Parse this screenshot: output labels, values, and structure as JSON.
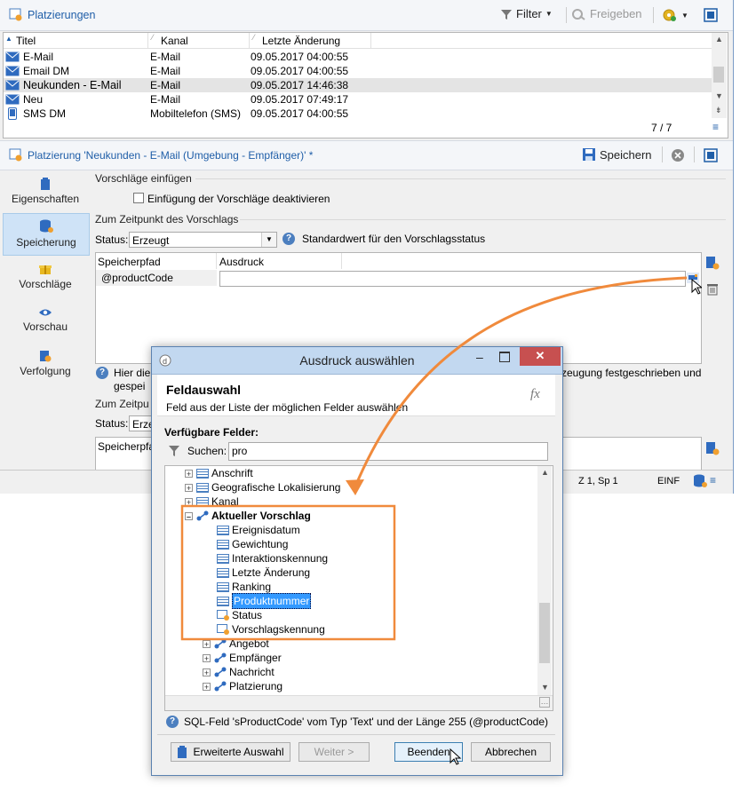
{
  "colors": {
    "accent": "#1f5ea8",
    "orange": "#f08a3c",
    "selection": "#3399ff"
  },
  "top": {
    "title": "Platzierungen",
    "filter": "Filter",
    "release": "Freigeben",
    "columns": [
      "Titel",
      "Kanal",
      "Letzte Änderung"
    ],
    "rows": [
      {
        "title": "E-Mail",
        "channel": "E-Mail",
        "date": "09.05.2017 04:00:55",
        "icon": "envelope-icon"
      },
      {
        "title": "Email DM",
        "channel": "E-Mail",
        "date": "09.05.2017 04:00:55",
        "icon": "envelope-icon"
      },
      {
        "title": "Neukunden - E-Mail",
        "channel": "E-Mail",
        "date": "09.05.2017 14:46:38",
        "icon": "envelope-icon"
      },
      {
        "title": "Neu",
        "channel": "E-Mail",
        "date": "09.05.2017 07:49:17",
        "icon": "envelope-icon"
      },
      {
        "title": "SMS DM",
        "channel": "Mobiltelefon (SMS)",
        "date": "09.05.2017 04:00:55",
        "icon": "mobile-icon"
      }
    ],
    "count": "7 / 7"
  },
  "detail": {
    "title": "Platzierung 'Neukunden - E-Mail (Umgebung - Empfänger)' *",
    "save": "Speichern",
    "nav": [
      "Eigenschaften",
      "Speicherung",
      "Vorschläge",
      "Vorschau",
      "Verfolgung"
    ],
    "section1": "Vorschläge einfügen",
    "checkbox": "Einfügung der Vorschläge deaktivieren",
    "section2": "Zum Zeitpunkt des Vorschlags",
    "status_label": "Status:",
    "status_value": "Erzeugt",
    "status_help": "Standardwert für den Vorschlagsstatus",
    "table_cols": [
      "Speicherpfad",
      "Ausdruck"
    ],
    "table_row": "@productCode",
    "note_left": "Hier die",
    "note_left2": "gespei",
    "note_right": "zeugung festgeschrieben und",
    "section3": "Zum Zeitpu",
    "status_value2": "Erze",
    "table_col2": "Speicherpfa",
    "status_bar": [
      "Z 1, Sp 1",
      "EINF"
    ]
  },
  "dialog": {
    "title": "Ausdruck auswählen",
    "heading": "Feldauswahl",
    "subheading": "Feld aus der Liste der möglichen Felder auswählen",
    "available": "Verfügbare Felder:",
    "search_label": "Suchen:",
    "search_value": "pro",
    "fx": "fx",
    "tree": [
      {
        "label": "Anschrift",
        "level": 1,
        "expander": "+",
        "kind": "table"
      },
      {
        "label": "Geografische Lokalisierung",
        "level": 1,
        "expander": "+",
        "kind": "table"
      },
      {
        "label": "Kanal",
        "level": 1,
        "expander": "+",
        "kind": "table"
      },
      {
        "label": "Aktueller Vorschlag",
        "level": 1,
        "expander": "-",
        "kind": "link",
        "bold": true
      },
      {
        "label": "Ereignisdatum",
        "level": 2,
        "kind": "field"
      },
      {
        "label": "Gewichtung",
        "level": 2,
        "kind": "field"
      },
      {
        "label": "Interaktionskennung",
        "level": 2,
        "kind": "field"
      },
      {
        "label": "Letzte Änderung",
        "level": 2,
        "kind": "field"
      },
      {
        "label": "Ranking",
        "level": 2,
        "kind": "field"
      },
      {
        "label": "Produktnummer",
        "level": 2,
        "kind": "field",
        "selected": true
      },
      {
        "label": "Status",
        "level": 2,
        "kind": "enum"
      },
      {
        "label": "Vorschlagskennung",
        "level": 2,
        "kind": "enum"
      },
      {
        "label": "Angebot",
        "level": 2,
        "expander": "+",
        "kind": "link"
      },
      {
        "label": "Empfänger",
        "level": 2,
        "expander": "+",
        "kind": "link"
      },
      {
        "label": "Nachricht",
        "level": 2,
        "expander": "+",
        "kind": "link"
      },
      {
        "label": "Platzierung",
        "level": 2,
        "expander": "+",
        "kind": "link"
      }
    ],
    "info": "SQL-Feld 'sProductCode' vom Typ 'Text' und der Länge 255 (@productCode)",
    "buttons": {
      "advanced": "Erweiterte Auswahl",
      "next": "Weiter >",
      "finish": "Beenden",
      "cancel": "Abbrechen"
    }
  }
}
